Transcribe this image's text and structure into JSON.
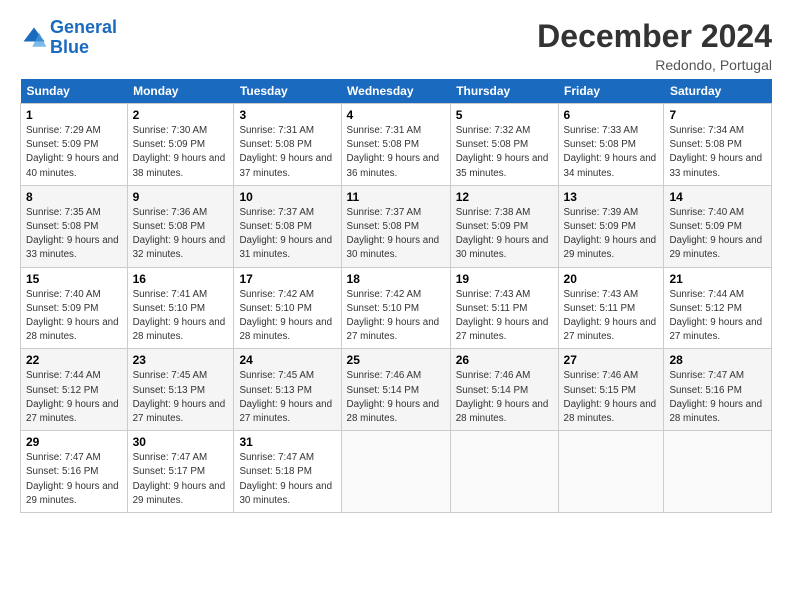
{
  "header": {
    "logo_line1": "General",
    "logo_line2": "Blue",
    "month_title": "December 2024",
    "location": "Redondo, Portugal"
  },
  "days_of_week": [
    "Sunday",
    "Monday",
    "Tuesday",
    "Wednesday",
    "Thursday",
    "Friday",
    "Saturday"
  ],
  "weeks": [
    [
      {
        "day": "1",
        "sunrise": "7:29 AM",
        "sunset": "5:09 PM",
        "daylight": "9 hours and 40 minutes."
      },
      {
        "day": "2",
        "sunrise": "7:30 AM",
        "sunset": "5:09 PM",
        "daylight": "9 hours and 38 minutes."
      },
      {
        "day": "3",
        "sunrise": "7:31 AM",
        "sunset": "5:08 PM",
        "daylight": "9 hours and 37 minutes."
      },
      {
        "day": "4",
        "sunrise": "7:31 AM",
        "sunset": "5:08 PM",
        "daylight": "9 hours and 36 minutes."
      },
      {
        "day": "5",
        "sunrise": "7:32 AM",
        "sunset": "5:08 PM",
        "daylight": "9 hours and 35 minutes."
      },
      {
        "day": "6",
        "sunrise": "7:33 AM",
        "sunset": "5:08 PM",
        "daylight": "9 hours and 34 minutes."
      },
      {
        "day": "7",
        "sunrise": "7:34 AM",
        "sunset": "5:08 PM",
        "daylight": "9 hours and 33 minutes."
      }
    ],
    [
      {
        "day": "8",
        "sunrise": "7:35 AM",
        "sunset": "5:08 PM",
        "daylight": "9 hours and 33 minutes."
      },
      {
        "day": "9",
        "sunrise": "7:36 AM",
        "sunset": "5:08 PM",
        "daylight": "9 hours and 32 minutes."
      },
      {
        "day": "10",
        "sunrise": "7:37 AM",
        "sunset": "5:08 PM",
        "daylight": "9 hours and 31 minutes."
      },
      {
        "day": "11",
        "sunrise": "7:37 AM",
        "sunset": "5:08 PM",
        "daylight": "9 hours and 30 minutes."
      },
      {
        "day": "12",
        "sunrise": "7:38 AM",
        "sunset": "5:09 PM",
        "daylight": "9 hours and 30 minutes."
      },
      {
        "day": "13",
        "sunrise": "7:39 AM",
        "sunset": "5:09 PM",
        "daylight": "9 hours and 29 minutes."
      },
      {
        "day": "14",
        "sunrise": "7:40 AM",
        "sunset": "5:09 PM",
        "daylight": "9 hours and 29 minutes."
      }
    ],
    [
      {
        "day": "15",
        "sunrise": "7:40 AM",
        "sunset": "5:09 PM",
        "daylight": "9 hours and 28 minutes."
      },
      {
        "day": "16",
        "sunrise": "7:41 AM",
        "sunset": "5:10 PM",
        "daylight": "9 hours and 28 minutes."
      },
      {
        "day": "17",
        "sunrise": "7:42 AM",
        "sunset": "5:10 PM",
        "daylight": "9 hours and 28 minutes."
      },
      {
        "day": "18",
        "sunrise": "7:42 AM",
        "sunset": "5:10 PM",
        "daylight": "9 hours and 27 minutes."
      },
      {
        "day": "19",
        "sunrise": "7:43 AM",
        "sunset": "5:11 PM",
        "daylight": "9 hours and 27 minutes."
      },
      {
        "day": "20",
        "sunrise": "7:43 AM",
        "sunset": "5:11 PM",
        "daylight": "9 hours and 27 minutes."
      },
      {
        "day": "21",
        "sunrise": "7:44 AM",
        "sunset": "5:12 PM",
        "daylight": "9 hours and 27 minutes."
      }
    ],
    [
      {
        "day": "22",
        "sunrise": "7:44 AM",
        "sunset": "5:12 PM",
        "daylight": "9 hours and 27 minutes."
      },
      {
        "day": "23",
        "sunrise": "7:45 AM",
        "sunset": "5:13 PM",
        "daylight": "9 hours and 27 minutes."
      },
      {
        "day": "24",
        "sunrise": "7:45 AM",
        "sunset": "5:13 PM",
        "daylight": "9 hours and 27 minutes."
      },
      {
        "day": "25",
        "sunrise": "7:46 AM",
        "sunset": "5:14 PM",
        "daylight": "9 hours and 28 minutes."
      },
      {
        "day": "26",
        "sunrise": "7:46 AM",
        "sunset": "5:14 PM",
        "daylight": "9 hours and 28 minutes."
      },
      {
        "day": "27",
        "sunrise": "7:46 AM",
        "sunset": "5:15 PM",
        "daylight": "9 hours and 28 minutes."
      },
      {
        "day": "28",
        "sunrise": "7:47 AM",
        "sunset": "5:16 PM",
        "daylight": "9 hours and 28 minutes."
      }
    ],
    [
      {
        "day": "29",
        "sunrise": "7:47 AM",
        "sunset": "5:16 PM",
        "daylight": "9 hours and 29 minutes."
      },
      {
        "day": "30",
        "sunrise": "7:47 AM",
        "sunset": "5:17 PM",
        "daylight": "9 hours and 29 minutes."
      },
      {
        "day": "31",
        "sunrise": "7:47 AM",
        "sunset": "5:18 PM",
        "daylight": "9 hours and 30 minutes."
      },
      null,
      null,
      null,
      null
    ]
  ]
}
